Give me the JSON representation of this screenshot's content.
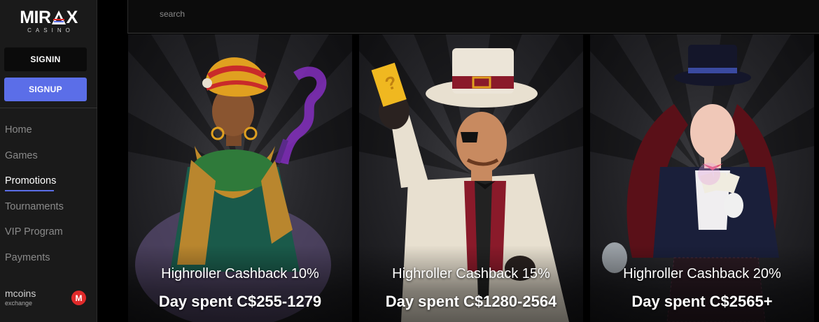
{
  "logo": {
    "main_left": "MIR",
    "main_a": "A",
    "main_right": "X",
    "sub": "CASINO"
  },
  "auth": {
    "signin_label": "SIGNIN",
    "signup_label": "SIGNUP"
  },
  "nav": {
    "items": [
      {
        "label": "Home"
      },
      {
        "label": "Games"
      },
      {
        "label": "Promotions",
        "active": true
      },
      {
        "label": "Tournaments"
      },
      {
        "label": "VIP Program"
      },
      {
        "label": "Payments"
      }
    ]
  },
  "mcoins": {
    "title": "mcoins",
    "subtitle": "exchange",
    "icon_letter": "M"
  },
  "search": {
    "placeholder": "search"
  },
  "promotions": [
    {
      "title": "Highroller Cashback 10%",
      "subtitle": "Day spent C$255-1279",
      "icon": "sorceress-illustration"
    },
    {
      "title": "Highroller Cashback 15%",
      "subtitle": "Day spent C$1280-2564",
      "icon": "gambler-top-hat-illustration"
    },
    {
      "title": "Highroller Cashback 20%",
      "subtitle": "Day spent C$2565+",
      "icon": "magician-top-hat-illustration"
    }
  ],
  "colors": {
    "accent": "#5b6ee8",
    "sidebar_bg": "#1a1a1a",
    "mcoin_badge": "#e02a2a"
  }
}
